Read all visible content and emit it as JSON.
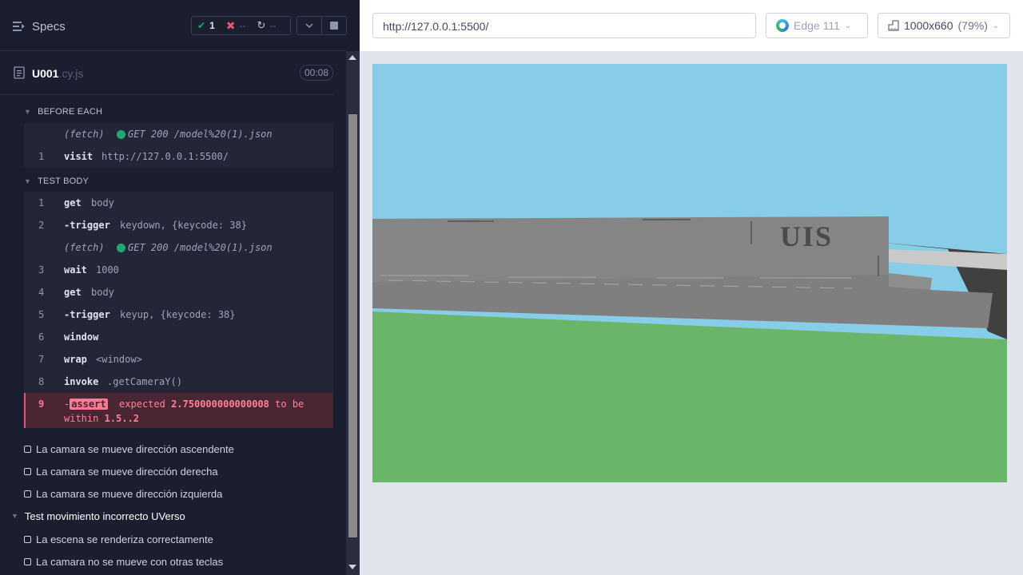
{
  "reporter": {
    "header": {
      "specs_label": "Specs",
      "passed": "1",
      "failed": "--",
      "pending": "--"
    },
    "spec": {
      "file_name": "U001",
      "file_ext": ".cy.js",
      "duration": "00:08"
    },
    "before_each": {
      "label": "BEFORE EACH",
      "commands": [
        {
          "type": "fetch",
          "name": "(fetch)",
          "message": "GET 200 /model%20(1).json"
        },
        {
          "num": "1",
          "name": "visit",
          "message": "http://127.0.0.1:5500/"
        }
      ]
    },
    "test_body": {
      "label": "TEST BODY",
      "commands": [
        {
          "num": "1",
          "name": "get",
          "message": "body"
        },
        {
          "num": "2",
          "name": "-trigger",
          "message": "keydown, {keycode: 38}"
        },
        {
          "type": "fetch",
          "name": "(fetch)",
          "message": "GET 200 /model%20(1).json"
        },
        {
          "num": "3",
          "name": "wait",
          "message": "1000"
        },
        {
          "num": "4",
          "name": "get",
          "message": "body"
        },
        {
          "num": "5",
          "name": "-trigger",
          "message": "keyup, {keycode: 38}"
        },
        {
          "num": "6",
          "name": "window",
          "message": ""
        },
        {
          "num": "7",
          "name": "wrap",
          "message": "<window>"
        },
        {
          "num": "8",
          "name": "invoke",
          "message": ".getCameraY()"
        }
      ],
      "error": {
        "num": "9",
        "prefix": "-",
        "badge": "assert",
        "expected_word": "expected",
        "value": "2.750000000000008",
        "tail": "to be within",
        "range": "1.5..2"
      }
    },
    "tests": [
      "La camara se mueve dirección ascendente",
      "La camara se mueve dirección derecha",
      "La camara se mueve dirección izquierda"
    ],
    "suite": {
      "title": "Test movimiento incorrecto UVerso",
      "tests": [
        "La escena se renderiza correctamente",
        "La camara no se mueve con otras teclas"
      ]
    }
  },
  "aut": {
    "url": "http://127.0.0.1:5500/",
    "browser": "Edge 111",
    "viewport": "1000x660",
    "scale": "(79%)",
    "scene_text": "UIS"
  },
  "colors": {
    "sky": "#87cde8",
    "building": "#858585",
    "ground": "#6bb56b",
    "pass": "#1fa971",
    "fail": "#e45770"
  }
}
